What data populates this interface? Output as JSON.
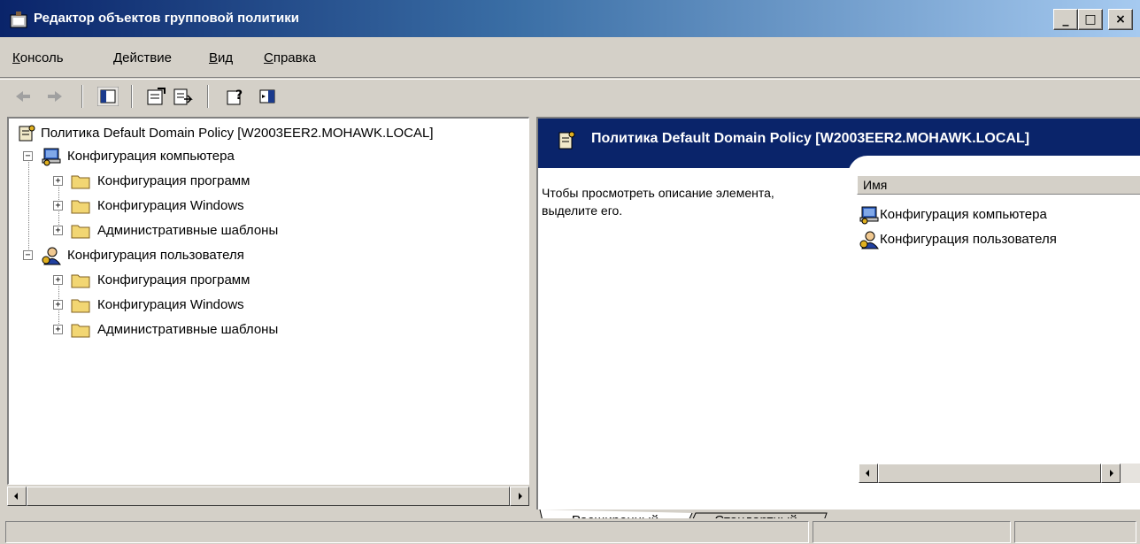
{
  "window": {
    "title": "Редактор объектов групповой политики",
    "controls": {
      "minimize": "_",
      "maximize": "□",
      "close": "×"
    }
  },
  "menubar": {
    "items": [
      {
        "label": "Консоль",
        "underline": "К",
        "rest": "онсоль"
      },
      {
        "label": "Действие",
        "underline": "Д",
        "rest": "ействие"
      },
      {
        "label": "Вид",
        "underline": "В",
        "rest": "ид"
      },
      {
        "label": "Справка",
        "underline": "С",
        "rest": "правка"
      }
    ]
  },
  "toolbar": {
    "icons": [
      "back-arrow-icon",
      "forward-arrow-icon",
      "show-hide-console-tree-icon",
      "properties-icon",
      "export-list-icon",
      "help-icon",
      "show-hide-action-pane-icon"
    ]
  },
  "tree": {
    "root": "Политика Default Domain Policy [W2003EER2.MOHAWK.LOCAL]",
    "computer": {
      "label": "Конфигурация компьютера",
      "children": [
        "Конфигурация программ",
        "Конфигурация Windows",
        "Административные шаблоны"
      ]
    },
    "user": {
      "label": "Конфигурация пользователя",
      "children": [
        "Конфигурация программ",
        "Конфигурация Windows",
        "Административные шаблоны"
      ]
    },
    "expander_collapsed": "+",
    "expander_expanded": "−"
  },
  "details": {
    "header": "Политика Default Domain Policy [W2003EER2.MOHAWK.LOCAL]",
    "description": "Чтобы просмотреть описание элемента, выделите его.",
    "column_name": "Имя",
    "items": [
      "Конфигурация компьютера",
      "Конфигурация пользователя"
    ]
  },
  "tabs": {
    "extended": "Расширенный",
    "standard": "Стандартный",
    "active": "extended"
  },
  "colors": {
    "title_start": "#0a246a",
    "title_end": "#a6caf0",
    "face": "#d4d0c8",
    "header_bg": "#0a246a",
    "folder": "#f2d673"
  }
}
